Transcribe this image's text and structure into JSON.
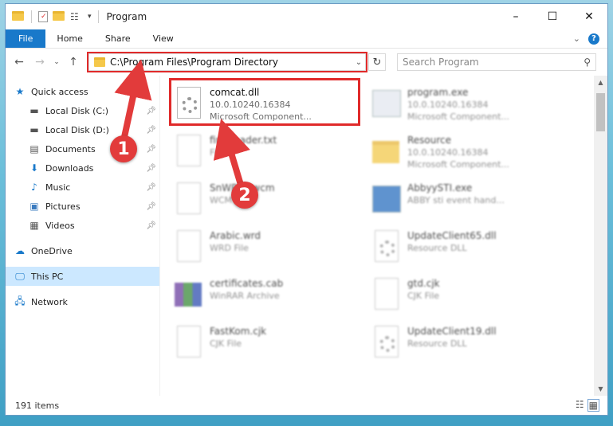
{
  "window": {
    "title": "Program"
  },
  "window_controls": {
    "minimize": "–",
    "maximize": "☐",
    "close": "✕"
  },
  "ribbon": {
    "tabs": [
      "File",
      "Home",
      "Share",
      "View"
    ],
    "help": "?",
    "expand": "⌄"
  },
  "address": {
    "path": "C:\\Program Files\\Program Directory"
  },
  "search": {
    "placeholder": "Search Program"
  },
  "sidebar": {
    "quick_access": "Quick access",
    "items": [
      {
        "label": "Local Disk (C:)"
      },
      {
        "label": "Local Disk (D:)"
      },
      {
        "label": "Documents"
      },
      {
        "label": "Downloads"
      },
      {
        "label": "Music"
      },
      {
        "label": "Pictures"
      },
      {
        "label": "Videos"
      }
    ],
    "onedrive": "OneDrive",
    "this_pc": "This PC",
    "network": "Network"
  },
  "files": [
    {
      "name": "comcat.dll",
      "line1": "10.0.10240.16384",
      "line2": "Microsoft Component..."
    },
    {
      "name": "program.exe",
      "line1": "10.0.10240.16384",
      "line2": "Microsoft Component..."
    },
    {
      "name": "fineReader.txt",
      "line1": "File",
      "line2": ""
    },
    {
      "name": "Resource",
      "line1": "10.0.10240.16384",
      "line2": "Microsoft Component..."
    },
    {
      "name": "SnWP12.wcm",
      "line1": "WCM File",
      "line2": ""
    },
    {
      "name": "AbbyySTI.exe",
      "line1": "ABBY sti event hand...",
      "line2": ""
    },
    {
      "name": "Arabic.wrd",
      "line1": "WRD File",
      "line2": ""
    },
    {
      "name": "UpdateClient65.dll",
      "line1": "Resource DLL",
      "line2": ""
    },
    {
      "name": "certificates.cab",
      "line1": "WinRAR Archive",
      "line2": ""
    },
    {
      "name": "gtd.cjk",
      "line1": "CJK File",
      "line2": ""
    },
    {
      "name": "FastKom.cjk",
      "line1": "CJK File",
      "line2": ""
    },
    {
      "name": "UpdateClient19.dll",
      "line1": "Resource DLL",
      "line2": ""
    }
  ],
  "status": {
    "count": "191 items"
  },
  "callouts": {
    "one": "1",
    "two": "2"
  },
  "colors": {
    "accent": "#1979ca",
    "highlight": "#e02a2a",
    "selected": "#cce8ff"
  }
}
